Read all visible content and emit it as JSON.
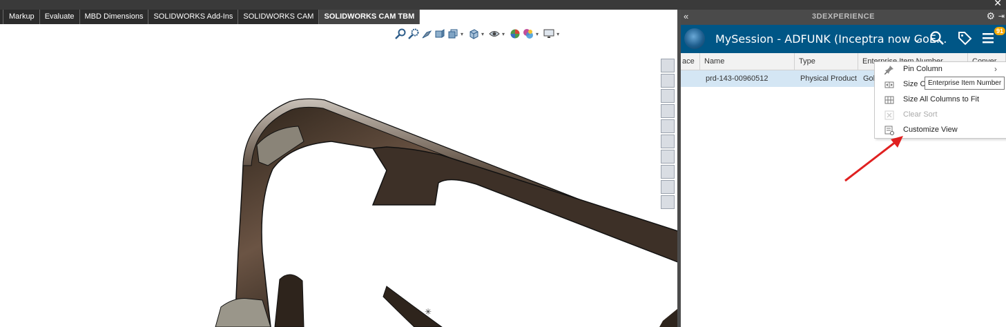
{
  "tabs": [
    {
      "label": "Markup"
    },
    {
      "label": "Evaluate"
    },
    {
      "label": "MBD Dimensions"
    },
    {
      "label": "SOLIDWORKS Add-Ins"
    },
    {
      "label": "SOLIDWORKS CAM"
    },
    {
      "label": "SOLIDWORKS CAM TBM",
      "active": true
    }
  ],
  "window": {
    "close_glyph": "✕"
  },
  "panel": {
    "title": "3DEXPERIENCE",
    "collapse_glyph": "«",
    "gear_glyph": "⚙",
    "pin_glyph": "⇥",
    "session_label": "MySession - ADFUNK (Inceptra now GoE...",
    "dropdown_glyph": "⌄",
    "notification_count": "91",
    "columns": [
      "ace",
      "Name",
      "Type",
      "Enterprise Item Number",
      "Conver"
    ],
    "rows": [
      {
        "name": "prd-143-00960512",
        "type": "Physical Product",
        "enterprise": "Gol"
      }
    ]
  },
  "context_menu": {
    "items": [
      {
        "label": "Pin Column",
        "icon": "pin-icon",
        "has_submenu": true,
        "disabled": false
      },
      {
        "label": "Size C",
        "icon": "size-column-icon",
        "has_submenu": false,
        "disabled": false
      },
      {
        "label": "Size All Columns to Fit",
        "icon": "size-all-columns-icon",
        "has_submenu": false,
        "disabled": false
      },
      {
        "label": "Clear Sort",
        "icon": "clear-sort-icon",
        "has_submenu": false,
        "disabled": true
      },
      {
        "label": "Customize View",
        "icon": "customize-view-icon",
        "has_submenu": false,
        "disabled": false
      }
    ],
    "submenu_glyph": "›"
  },
  "tooltip": {
    "text": "Enterprise Item Number"
  },
  "colors": {
    "session_bar": "#005686",
    "selected_row": "#d4e6f4",
    "annotation_arrow": "#e02020",
    "model_body": "#4a3b30"
  }
}
